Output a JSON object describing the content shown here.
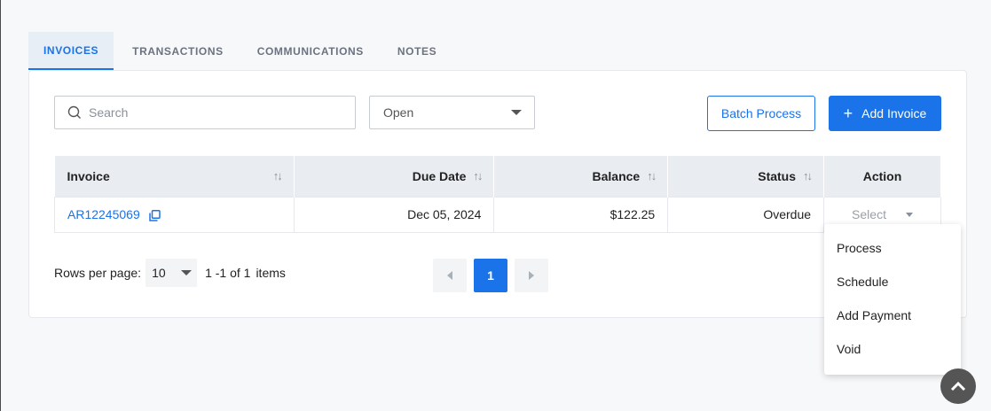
{
  "tabs": [
    {
      "label": "INVOICES"
    },
    {
      "label": "TRANSACTIONS"
    },
    {
      "label": "COMMUNICATIONS"
    },
    {
      "label": "NOTES"
    }
  ],
  "toolbar": {
    "search_placeholder": "Search",
    "status_filter": "Open",
    "batch_label": "Batch Process",
    "add_label": "Add Invoice"
  },
  "table": {
    "headers": {
      "invoice": "Invoice",
      "due_date": "Due Date",
      "balance": "Balance",
      "status": "Status",
      "action": "Action"
    },
    "rows": [
      {
        "invoice": "AR12245069",
        "due_date": "Dec 05, 2024",
        "balance": "$122.25",
        "status": "Overdue",
        "action": "Select"
      }
    ]
  },
  "footer": {
    "rows_label": "Rows per page:",
    "rows_value": "10",
    "range": "1 -1 of 1",
    "items": "items"
  },
  "pagination": {
    "current": "1"
  },
  "action_menu": {
    "items": [
      "Process",
      "Schedule",
      "Add Payment",
      "Void"
    ]
  },
  "colors": {
    "accent": "#1a73e8"
  }
}
